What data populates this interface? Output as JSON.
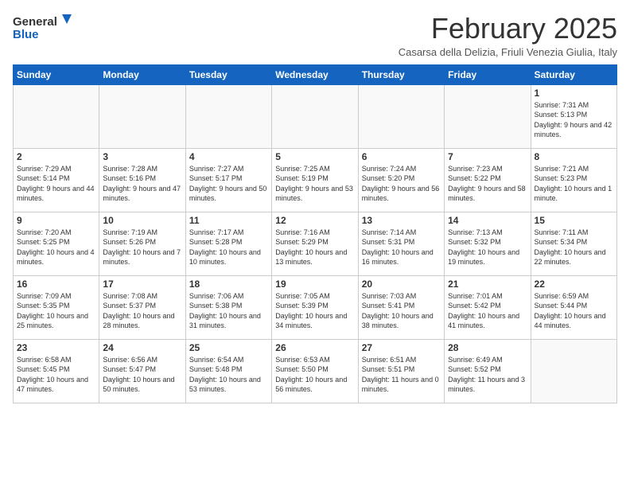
{
  "header": {
    "logo_general": "General",
    "logo_blue": "Blue",
    "title": "February 2025",
    "subtitle": "Casarsa della Delizia, Friuli Venezia Giulia, Italy"
  },
  "weekdays": [
    "Sunday",
    "Monday",
    "Tuesday",
    "Wednesday",
    "Thursday",
    "Friday",
    "Saturday"
  ],
  "weeks": [
    [
      {
        "day": "",
        "info": ""
      },
      {
        "day": "",
        "info": ""
      },
      {
        "day": "",
        "info": ""
      },
      {
        "day": "",
        "info": ""
      },
      {
        "day": "",
        "info": ""
      },
      {
        "day": "",
        "info": ""
      },
      {
        "day": "1",
        "info": "Sunrise: 7:31 AM\nSunset: 5:13 PM\nDaylight: 9 hours and 42 minutes."
      }
    ],
    [
      {
        "day": "2",
        "info": "Sunrise: 7:29 AM\nSunset: 5:14 PM\nDaylight: 9 hours and 44 minutes."
      },
      {
        "day": "3",
        "info": "Sunrise: 7:28 AM\nSunset: 5:16 PM\nDaylight: 9 hours and 47 minutes."
      },
      {
        "day": "4",
        "info": "Sunrise: 7:27 AM\nSunset: 5:17 PM\nDaylight: 9 hours and 50 minutes."
      },
      {
        "day": "5",
        "info": "Sunrise: 7:25 AM\nSunset: 5:19 PM\nDaylight: 9 hours and 53 minutes."
      },
      {
        "day": "6",
        "info": "Sunrise: 7:24 AM\nSunset: 5:20 PM\nDaylight: 9 hours and 56 minutes."
      },
      {
        "day": "7",
        "info": "Sunrise: 7:23 AM\nSunset: 5:22 PM\nDaylight: 9 hours and 58 minutes."
      },
      {
        "day": "8",
        "info": "Sunrise: 7:21 AM\nSunset: 5:23 PM\nDaylight: 10 hours and 1 minute."
      }
    ],
    [
      {
        "day": "9",
        "info": "Sunrise: 7:20 AM\nSunset: 5:25 PM\nDaylight: 10 hours and 4 minutes."
      },
      {
        "day": "10",
        "info": "Sunrise: 7:19 AM\nSunset: 5:26 PM\nDaylight: 10 hours and 7 minutes."
      },
      {
        "day": "11",
        "info": "Sunrise: 7:17 AM\nSunset: 5:28 PM\nDaylight: 10 hours and 10 minutes."
      },
      {
        "day": "12",
        "info": "Sunrise: 7:16 AM\nSunset: 5:29 PM\nDaylight: 10 hours and 13 minutes."
      },
      {
        "day": "13",
        "info": "Sunrise: 7:14 AM\nSunset: 5:31 PM\nDaylight: 10 hours and 16 minutes."
      },
      {
        "day": "14",
        "info": "Sunrise: 7:13 AM\nSunset: 5:32 PM\nDaylight: 10 hours and 19 minutes."
      },
      {
        "day": "15",
        "info": "Sunrise: 7:11 AM\nSunset: 5:34 PM\nDaylight: 10 hours and 22 minutes."
      }
    ],
    [
      {
        "day": "16",
        "info": "Sunrise: 7:09 AM\nSunset: 5:35 PM\nDaylight: 10 hours and 25 minutes."
      },
      {
        "day": "17",
        "info": "Sunrise: 7:08 AM\nSunset: 5:37 PM\nDaylight: 10 hours and 28 minutes."
      },
      {
        "day": "18",
        "info": "Sunrise: 7:06 AM\nSunset: 5:38 PM\nDaylight: 10 hours and 31 minutes."
      },
      {
        "day": "19",
        "info": "Sunrise: 7:05 AM\nSunset: 5:39 PM\nDaylight: 10 hours and 34 minutes."
      },
      {
        "day": "20",
        "info": "Sunrise: 7:03 AM\nSunset: 5:41 PM\nDaylight: 10 hours and 38 minutes."
      },
      {
        "day": "21",
        "info": "Sunrise: 7:01 AM\nSunset: 5:42 PM\nDaylight: 10 hours and 41 minutes."
      },
      {
        "day": "22",
        "info": "Sunrise: 6:59 AM\nSunset: 5:44 PM\nDaylight: 10 hours and 44 minutes."
      }
    ],
    [
      {
        "day": "23",
        "info": "Sunrise: 6:58 AM\nSunset: 5:45 PM\nDaylight: 10 hours and 47 minutes."
      },
      {
        "day": "24",
        "info": "Sunrise: 6:56 AM\nSunset: 5:47 PM\nDaylight: 10 hours and 50 minutes."
      },
      {
        "day": "25",
        "info": "Sunrise: 6:54 AM\nSunset: 5:48 PM\nDaylight: 10 hours and 53 minutes."
      },
      {
        "day": "26",
        "info": "Sunrise: 6:53 AM\nSunset: 5:50 PM\nDaylight: 10 hours and 56 minutes."
      },
      {
        "day": "27",
        "info": "Sunrise: 6:51 AM\nSunset: 5:51 PM\nDaylight: 11 hours and 0 minutes."
      },
      {
        "day": "28",
        "info": "Sunrise: 6:49 AM\nSunset: 5:52 PM\nDaylight: 11 hours and 3 minutes."
      },
      {
        "day": "",
        "info": ""
      }
    ]
  ]
}
